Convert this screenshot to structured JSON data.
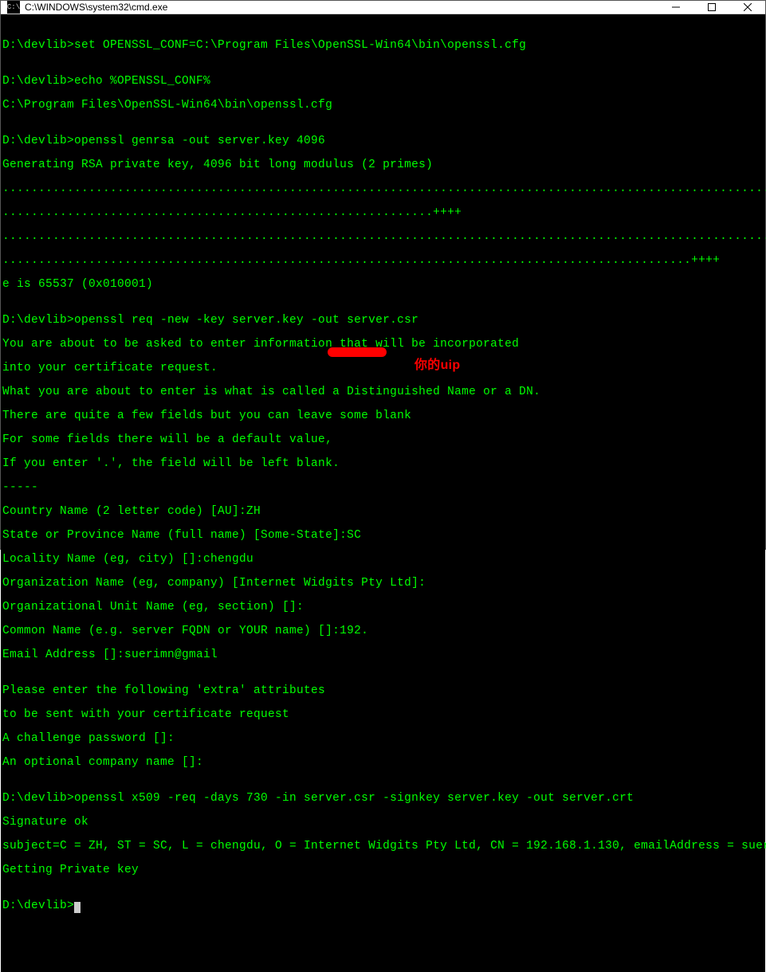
{
  "titlebar": {
    "icon_label": "C:\\",
    "title": "C:\\WINDOWS\\system32\\cmd.exe"
  },
  "term": {
    "l01": "",
    "l02": "D:\\devlib>set OPENSSL_CONF=C:\\Program Files\\OpenSSL-Win64\\bin\\openssl.cfg",
    "l03": "",
    "l04": "D:\\devlib>echo %OPENSSL_CONF%",
    "l05": "C:\\Program Files\\OpenSSL-Win64\\bin\\openssl.cfg",
    "l06": "",
    "l07": "D:\\devlib>openssl genrsa -out server.key 4096",
    "l08": "Generating RSA private key, 4096 bit long modulus (2 primes)",
    "l09": ".........................................................................................................................",
    "l10": "............................................................++++",
    "l11": ".........................................................................................................................",
    "l12": "................................................................................................++++",
    "l13": "e is 65537 (0x010001)",
    "l14": "",
    "l15": "D:\\devlib>openssl req -new -key server.key -out server.csr",
    "l16": "You are about to be asked to enter information that will be incorporated",
    "l17": "into your certificate request.",
    "l18": "What you are about to enter is what is called a Distinguished Name or a DN.",
    "l19": "There are quite a few fields but you can leave some blank",
    "l20": "For some fields there will be a default value,",
    "l21": "If you enter '.', the field will be left blank.",
    "l22": "-----",
    "l23": "Country Name (2 letter code) [AU]:ZH",
    "l24": "State or Province Name (full name) [Some-State]:SC",
    "l25": "Locality Name (eg, city) []:chengdu",
    "l26": "Organization Name (eg, company) [Internet Widgits Pty Ltd]:",
    "l27": "Organizational Unit Name (eg, section) []:",
    "l28": "Common Name (e.g. server FQDN or YOUR name) []:192.",
    "l29": "Email Address []:suerimn@gmail",
    "l30": "",
    "l31": "Please enter the following 'extra' attributes",
    "l32": "to be sent with your certificate request",
    "l33": "A challenge password []:",
    "l34": "An optional company name []:",
    "l35": "",
    "l36": "D:\\devlib>openssl x509 -req -days 730 -in server.csr -signkey server.key -out server.crt",
    "l37": "Signature ok",
    "l38": "subject=C = ZH, ST = SC, L = chengdu, O = Internet Widgits Pty Ltd, CN = 192.168.1.130, emailAddress = suerimn@gmail",
    "l39": "Getting Private key",
    "l40": "",
    "l41": "D:\\devlib>"
  },
  "annotation": {
    "text": "你的uip"
  }
}
